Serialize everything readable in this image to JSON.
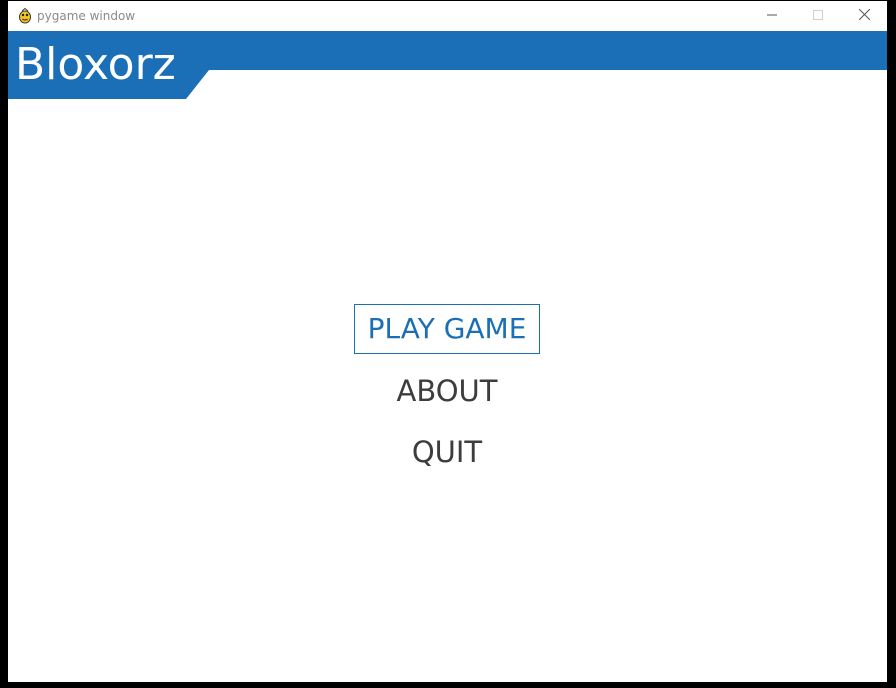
{
  "window": {
    "title": "pygame window",
    "icon": "pygame-snake-icon",
    "controls": {
      "minimize_icon": "minimize-icon",
      "maximize_icon": "maximize-icon",
      "close_icon": "close-icon"
    }
  },
  "game": {
    "title": "Bloxorz",
    "banner_color": "#1a6fb7",
    "menu": {
      "selected": "PLAY GAME",
      "items": [
        {
          "label": "PLAY GAME"
        },
        {
          "label": "ABOUT"
        },
        {
          "label": "QUIT"
        }
      ],
      "selected_color": "#1a6fb7",
      "item_color": "#3d3d3d"
    }
  }
}
